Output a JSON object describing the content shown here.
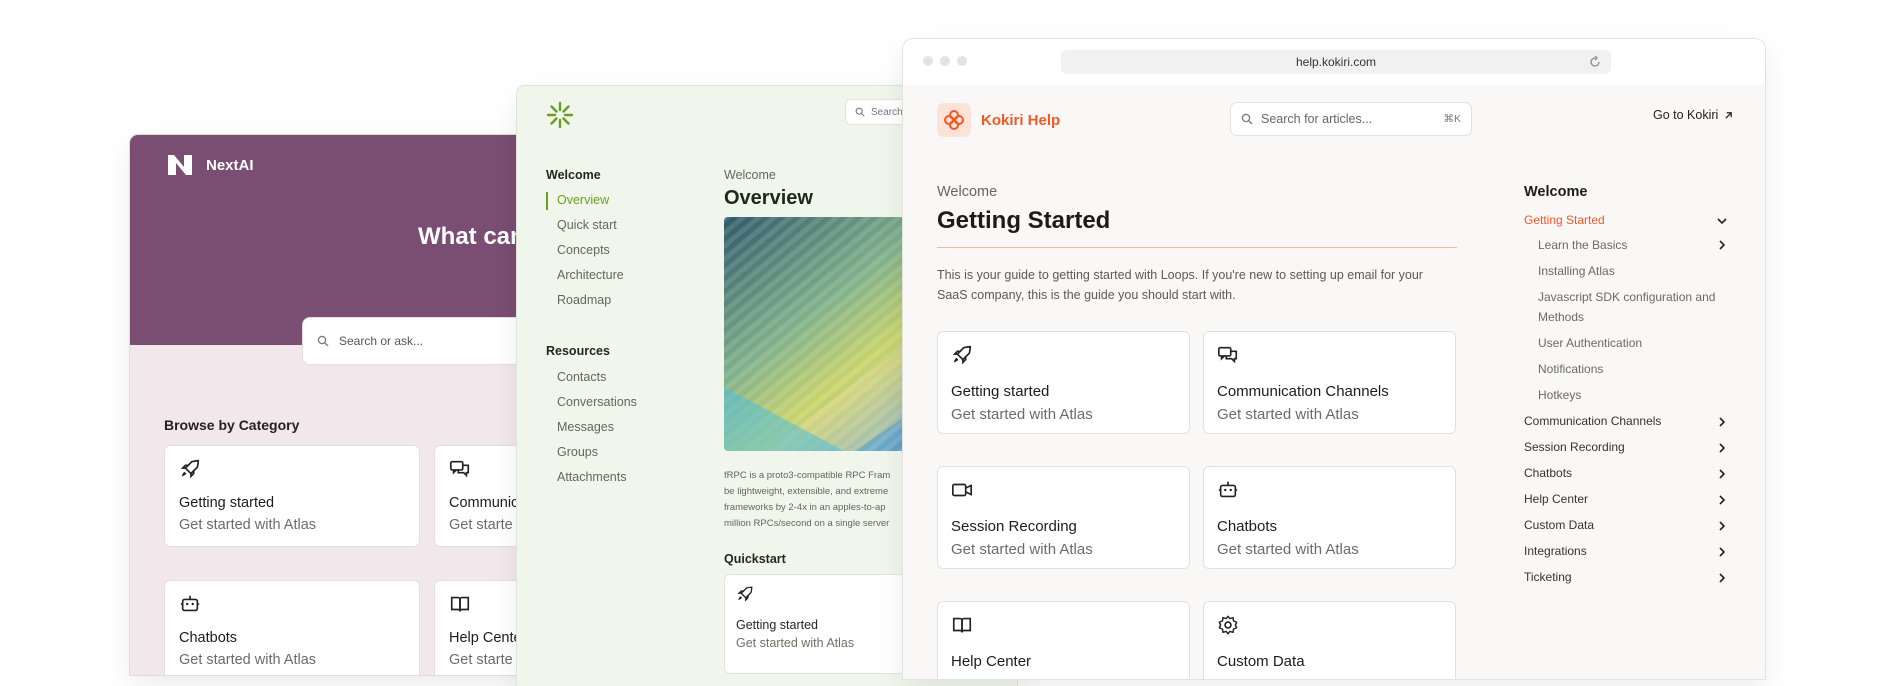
{
  "nextai": {
    "brand": "NextAI",
    "hero_title": "What can",
    "search_placeholder": "Search or ask...",
    "browse_heading": "Browse by Category",
    "cards": [
      {
        "icon": "rocket-icon",
        "title": "Getting started",
        "subtitle": "Get started with Atlas"
      },
      {
        "icon": "chat-icon",
        "title": "Communic",
        "subtitle": "Get starte"
      },
      {
        "icon": "robot-icon",
        "title": "Chatbots",
        "subtitle": "Get started with Atlas"
      },
      {
        "icon": "book-icon",
        "title": "Help Cente",
        "subtitle": "Get starte"
      }
    ],
    "colors": {
      "hero": "#7a4d72",
      "background": "#f2e8ec"
    }
  },
  "docs": {
    "search_placeholder": "Search",
    "nav_welcome": "Welcome",
    "nav_welcome_items": [
      "Overview",
      "Quick start",
      "Concepts",
      "Architecture",
      "Roadmap"
    ],
    "nav_resources": "Resources",
    "nav_resources_items": [
      "Contacts",
      "Conversations",
      "Messages",
      "Groups",
      "Attachments"
    ],
    "crumb": "Welcome",
    "title": "Overview",
    "paragraph_lines": [
      "fRPC is a proto3-compatible RPC Fram",
      "be lightweight, extensible, and extreme",
      "frameworks by 2-4x in an apples-to-ap",
      "million RPCs/second on a single server"
    ],
    "quickstart": "Quickstart",
    "card": {
      "title": "Getting started",
      "subtitle": "Get started with Atlas"
    },
    "colors": {
      "accent": "#6a9e23",
      "background": "#f1f6ec"
    }
  },
  "kokiri": {
    "url": "help.kokiri.com",
    "brand": "Kokiri Help",
    "search_placeholder": "Search for articles...",
    "search_shortcut": "⌘K",
    "go_link": "Go to Kokiri",
    "crumb": "Welcome",
    "title": "Getting Started",
    "intro": "This is your guide to getting started with Loops. If you're new to setting up email for your SaaS company, this is the guide you should start with.",
    "cards": [
      {
        "icon": "rocket-icon",
        "title": "Getting started",
        "subtitle": "Get started with Atlas"
      },
      {
        "icon": "chat-icon",
        "title": "Communication Channels",
        "subtitle": "Get started with Atlas"
      },
      {
        "icon": "video-icon",
        "title": "Session Recording",
        "subtitle": "Get started with Atlas"
      },
      {
        "icon": "robot-icon",
        "title": "Chatbots",
        "subtitle": "Get started with Atlas"
      },
      {
        "icon": "book-icon",
        "title": "Help Center",
        "subtitle": ""
      },
      {
        "icon": "gear-icon",
        "title": "Custom Data",
        "subtitle": ""
      }
    ],
    "toc_heading": "Welcome",
    "toc_active": "Getting Started",
    "toc_sub": [
      "Learn the Basics",
      "Installing Atlas",
      "Javascript SDK configuration and Methods",
      "User Authentication",
      "Notifications",
      "Hotkeys"
    ],
    "toc_items": [
      "Communication Channels",
      "Session Recording",
      "Chatbots",
      "Help Center",
      "Custom Data",
      "Integrations",
      "Ticketing"
    ],
    "colors": {
      "accent": "#f05a24",
      "background": "#f9f8f6"
    }
  }
}
